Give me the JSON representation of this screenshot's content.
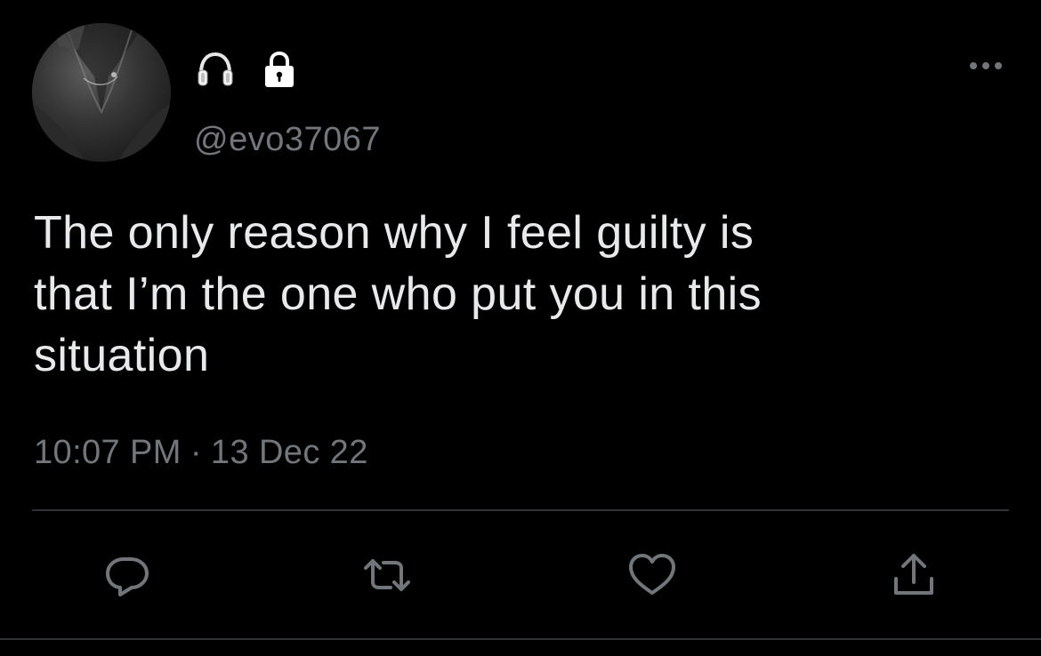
{
  "tweet": {
    "handle": "@evo37067",
    "name_emojis": [
      "headphones-icon",
      "lock-icon"
    ],
    "text": "The only reason why I feel guilty is\nthat I’m the one who put you in this\nsituation",
    "time": "10:07 PM",
    "separator": "·",
    "date": "13 Dec 22"
  },
  "actions": [
    "reply-icon",
    "retweet-icon",
    "like-icon",
    "share-icon"
  ],
  "colors": {
    "background": "#000000",
    "text": "#e7e9ea",
    "muted": "#71767b",
    "divider": "#2f3336"
  }
}
